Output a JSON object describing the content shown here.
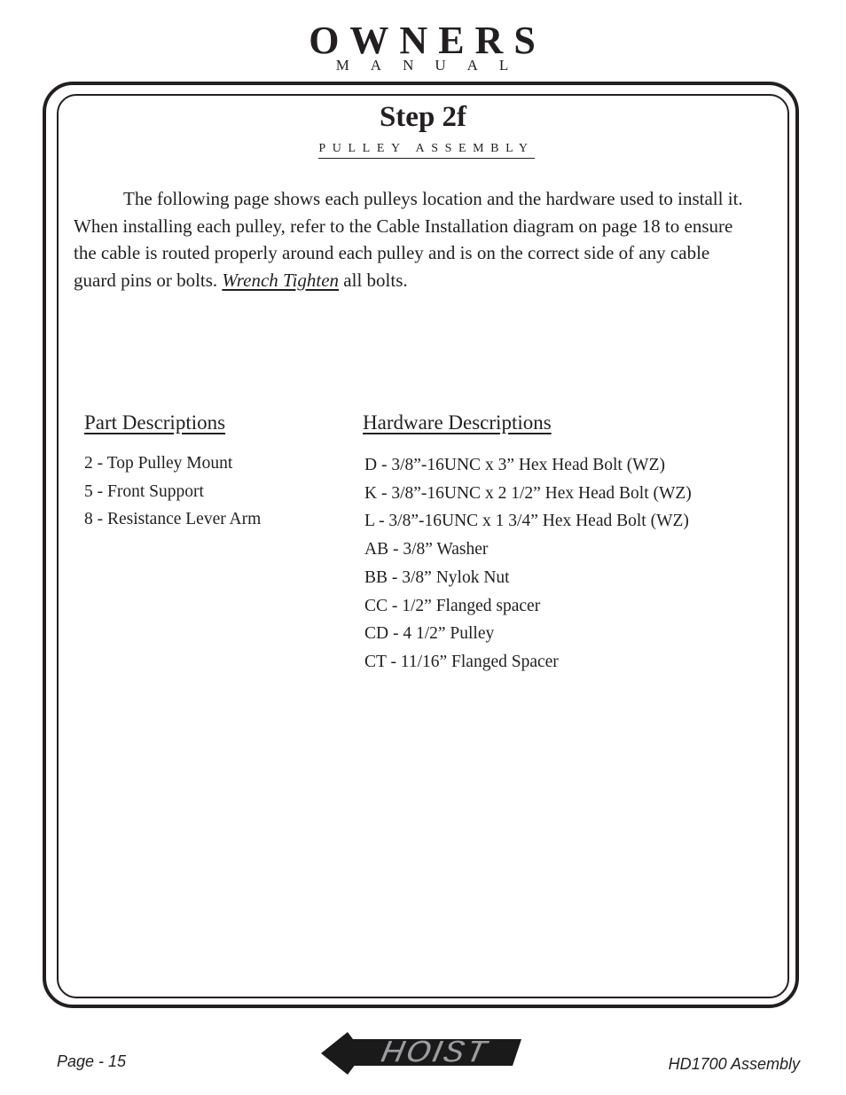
{
  "header": {
    "title": "OWNERS",
    "subtitle": "MANUAL"
  },
  "step": {
    "title": "Step 2f",
    "subtitle": "PULLEY ASSEMBLY"
  },
  "intro": {
    "text_before": "The following page shows each pulleys location and the hardware used to install it.  When installing each pulley, refer to the Cable Installation diagram on page 18 to ensure the cable is routed properly around each pulley and is on the correct side of any cable guard pins or bolts.  ",
    "emphasis": "Wrench Tighten",
    "text_after": " all bolts."
  },
  "parts": {
    "heading": "Part Descriptions",
    "items": [
      "2 - Top Pulley Mount",
      "5 - Front Support",
      "8 - Resistance Lever Arm"
    ]
  },
  "hardware": {
    "heading": "Hardware Descriptions",
    "items": [
      "D - 3/8”-16UNC x 3” Hex Head Bolt (WZ)",
      "K - 3/8”-16UNC x 2 1/2” Hex Head Bolt (WZ)",
      "L - 3/8”-16UNC x 1 3/4” Hex Head Bolt (WZ)",
      "AB - 3/8” Washer",
      "BB - 3/8” Nylok Nut",
      "CC - 1/2” Flanged spacer",
      "CD - 4 1/2” Pulley",
      "CT - 11/16” Flanged Spacer"
    ]
  },
  "footer": {
    "page": "Page - 15",
    "model": "HD1700 Assembly",
    "logo_text": "HOIST",
    "logo_colors": {
      "fill": "#9a9c9f",
      "outline": "#1a1a1a"
    }
  }
}
